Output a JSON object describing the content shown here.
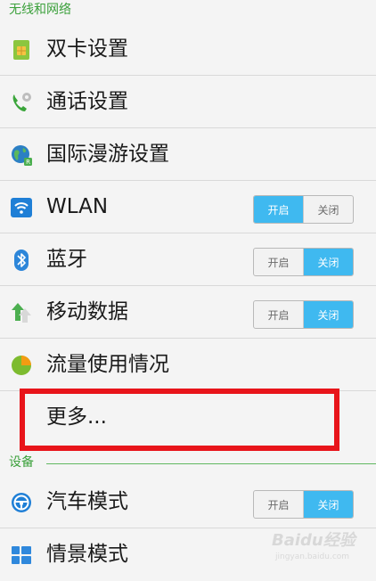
{
  "sections": {
    "wireless": {
      "title": "无线和网络"
    },
    "device": {
      "title": "设备"
    }
  },
  "rows": {
    "dual_sim": {
      "label": "双卡设置",
      "icon": "sim-card-icon"
    },
    "call": {
      "label": "通话设置",
      "icon": "phone-gear-icon"
    },
    "roaming": {
      "label": "国际漫游设置",
      "icon": "globe-roaming-icon"
    },
    "wlan": {
      "label": "WLAN",
      "icon": "wifi-icon",
      "on_label": "开启",
      "off_label": "关闭",
      "state": "on"
    },
    "bluetooth": {
      "label": "蓝牙",
      "icon": "bluetooth-icon",
      "on_label": "开启",
      "off_label": "关闭",
      "state": "off"
    },
    "mobile_data": {
      "label": "移动数据",
      "icon": "mobile-data-icon",
      "on_label": "开启",
      "off_label": "关闭",
      "state": "off"
    },
    "data_usage": {
      "label": "流量使用情况",
      "icon": "pie-chart-icon"
    },
    "more": {
      "label": "更多..."
    },
    "car_mode": {
      "label": "汽车模式",
      "icon": "steering-wheel-icon",
      "on_label": "开启",
      "off_label": "关闭",
      "state": "off"
    },
    "scene_mode": {
      "label": "情景模式",
      "icon": "scene-grid-icon"
    }
  },
  "colors": {
    "accent_green": "#3ba03b",
    "toggle_on": "#3fb9f0",
    "highlight": "#e8141a"
  },
  "watermark": {
    "text": "Baidu经验",
    "sub": "jingyan.baidu.com"
  }
}
